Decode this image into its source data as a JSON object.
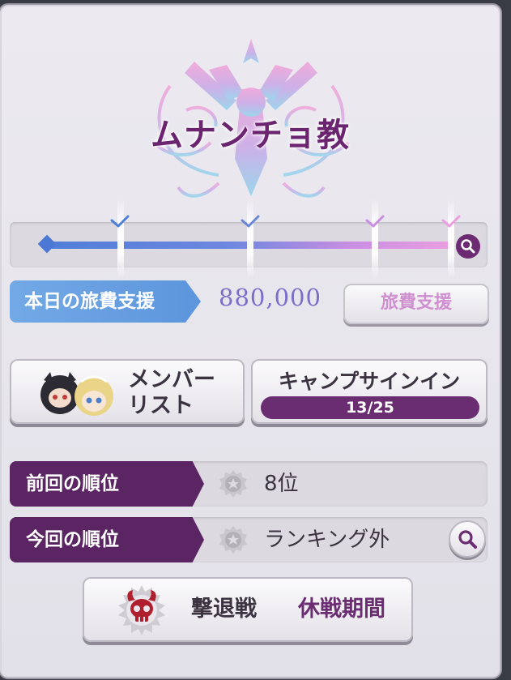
{
  "guild": {
    "name": "ムナンチョ教"
  },
  "progress": {
    "checkpoints_reached": 4
  },
  "support": {
    "label": "本日の旅費支援",
    "amount": "880,000",
    "button_label": "旅費支援"
  },
  "members": {
    "button_label_line1": "メンバー",
    "button_label_line2": "リスト"
  },
  "camp": {
    "button_label": "キャンプサインイン",
    "progress_text": "13/25",
    "progress_value": 13,
    "progress_max": 25
  },
  "ranking": {
    "previous_label": "前回の順位",
    "previous_value": "8位",
    "current_label": "今回の順位",
    "current_value": "ランキング外"
  },
  "battle": {
    "label": "撃退戦",
    "status": "休戦期間"
  },
  "colors": {
    "accent_purple": "#6b2d72",
    "tag_blue": "#5d95dd",
    "support_amount": "#7b6ec9",
    "support_button_text": "#d08fd0"
  },
  "icons": {
    "track_search": "search-icon",
    "rank_search": "search-icon",
    "medal": "medal-icon",
    "battle": "skull-icon"
  }
}
